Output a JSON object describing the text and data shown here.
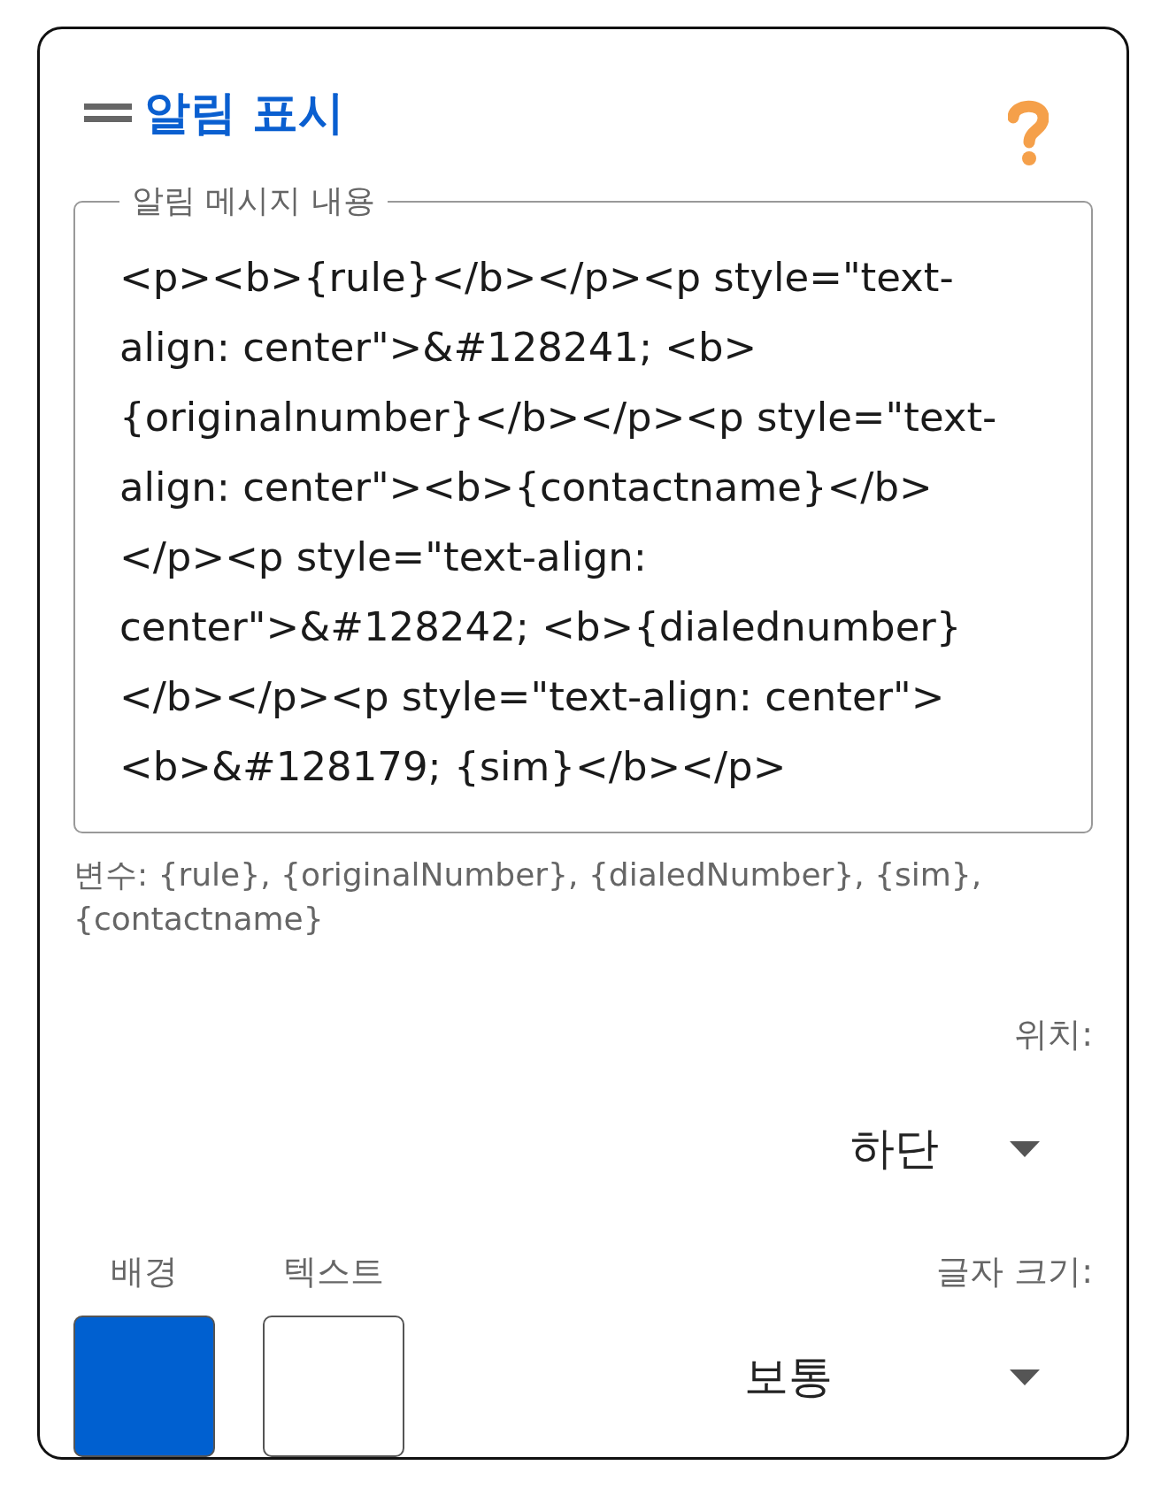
{
  "header": {
    "title": "알림 표시"
  },
  "message": {
    "label": "알림 메시지 내용",
    "value": "<p><b>{rule}</b></p><p style=\"text-align: center\">&#128241; <b>{originalnumber}</b></p><p style=\"text-align: center\"><b>{contactname}</b></p><p style=\"text-align: center\">&#128242; <b>{dialednumber}</b></p><p style=\"text-align: center\"><b>&#128179; {sim}</b></p>"
  },
  "variables_hint": "변수: {rule}, {originalNumber}, {dialedNumber}, {sim}, {contactname}",
  "position": {
    "label": "위치:",
    "value": "하단"
  },
  "colors": [
    {
      "label": "배경",
      "color": "#0060d0"
    },
    {
      "label": "텍스트",
      "color": "#ffffff"
    }
  ],
  "font_size": {
    "label": "글자 크기:",
    "value": "보통"
  }
}
